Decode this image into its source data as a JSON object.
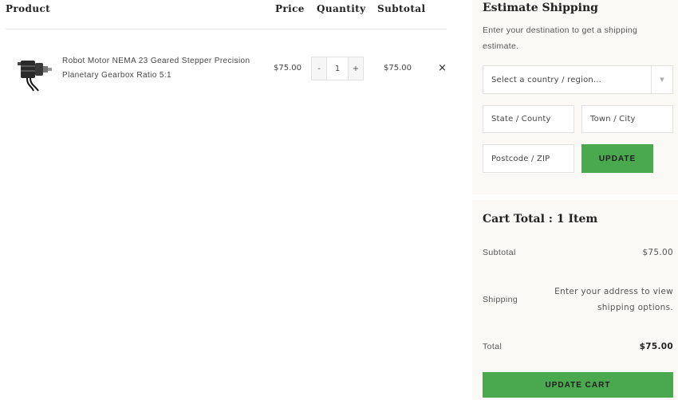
{
  "table": {
    "headers": {
      "product": "Product",
      "price": "Price",
      "quantity": "Quantity",
      "subtotal": "Subtotal"
    },
    "item": {
      "name": "Robot Motor NEMA 23 Geared Stepper Precision Planetary Gearbox Ratio 5:1",
      "price": "$75.00",
      "qty_minus": "-",
      "qty_value": "1",
      "qty_plus": "+",
      "subtotal": "$75.00",
      "remove": "×",
      "thumb_icon": "stepper-motor-image"
    }
  },
  "shipping": {
    "title": "Estimate Shipping",
    "description": "Enter your destination to get a shipping estimate.",
    "country_selected": "Select a country / region…",
    "state_placeholder": "State / County",
    "city_placeholder": "Town / City",
    "postcode_placeholder": "Postcode / ZIP",
    "update_label": "UPDATE"
  },
  "totals": {
    "title": "Cart Total : 1 Item",
    "subtotal_label": "Subtotal",
    "subtotal_value": "$75.00",
    "shipping_label": "Shipping",
    "shipping_note": "Enter your address to view shipping options.",
    "total_label": "Total",
    "total_value": "$75.00",
    "update_cart_label": "UPDATE CART"
  },
  "colors": {
    "accent": "#4aa84f",
    "panel_bg": "#faf9f6"
  }
}
